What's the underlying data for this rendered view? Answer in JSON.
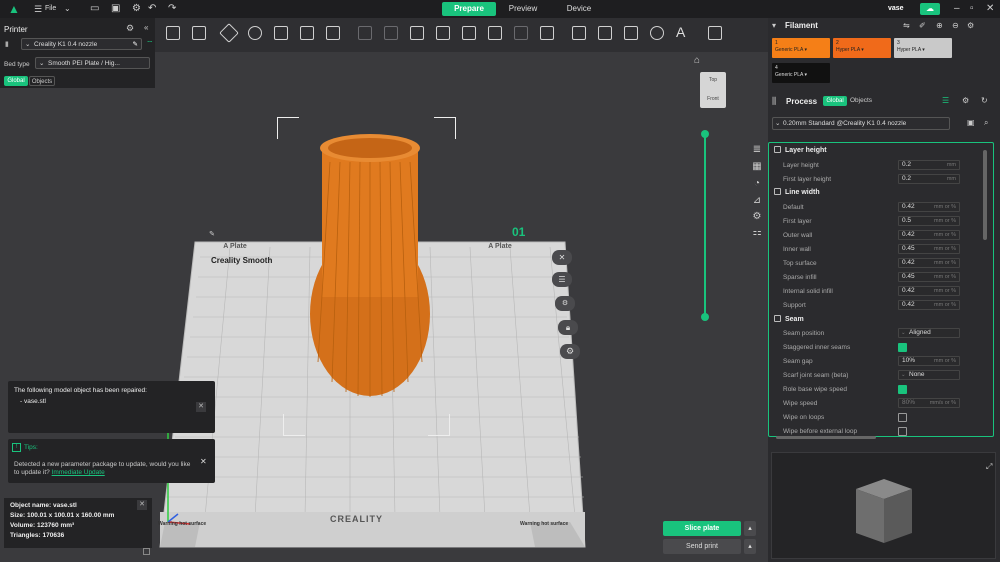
{
  "topbar": {
    "file_label": "File",
    "tabs": [
      "Prepare",
      "Preview",
      "Device"
    ],
    "user": "vase"
  },
  "printer": {
    "title": "Printer",
    "printer_name": "Creality K1 0.4 nozzle",
    "bed_label": "Bed type",
    "bed_value": "Smooth PEI Plate / Hig...",
    "tab_global": "Global",
    "tab_objects": "Objects"
  },
  "plate": {
    "label_left": "A Plate",
    "label_right": "A Plate",
    "name": "Creality Smooth",
    "number": "01",
    "brand": "CREALITY",
    "warning": "Warning hot surface"
  },
  "view_cube": {
    "top": "Top",
    "front": "Front"
  },
  "notices": {
    "repair_title": "The following model object has been repaired:",
    "repair_item": "- vase.stl",
    "tips_title": "Tips:",
    "tips_text": "Detected a new parameter package to update, would you like to update it?",
    "tips_link": "Immediate Update"
  },
  "object_info": {
    "name": "Object name: vase.stl",
    "size": "Size: 100.01 x 100.01 x 160.00 mm",
    "volume": "Volume: 123760 mm³",
    "triangles": "Triangles: 170636"
  },
  "actions": {
    "slice": "Slice plate",
    "send": "Send print"
  },
  "filament": {
    "title": "Filament",
    "slots": [
      {
        "num": "1",
        "name": "Generic PLA ▾",
        "color": "#f57f17"
      },
      {
        "num": "2",
        "name": "Hyper PLA ▾",
        "color": "#f06a1a"
      },
      {
        "num": "3",
        "name": "Hyper PLA ▾",
        "color": "#c9c9c9"
      },
      {
        "num": "4",
        "name": "Generic PLA ▾",
        "color": "#111111"
      }
    ]
  },
  "process": {
    "title": "Process",
    "tab_global": "Global",
    "tab_objects": "Objects",
    "profile": "0.20mm Standard @Creality K1 0.4 nozzle",
    "sections": {
      "layer_height": "Layer height",
      "line_width": "Line width",
      "seam": "Seam"
    },
    "layer_height": [
      {
        "label": "Layer height",
        "value": "0.2",
        "unit": "mm"
      },
      {
        "label": "First layer height",
        "value": "0.2",
        "unit": "mm"
      }
    ],
    "line_width": [
      {
        "label": "Default",
        "value": "0.42",
        "unit": "mm or %"
      },
      {
        "label": "First layer",
        "value": "0.5",
        "unit": "mm or %"
      },
      {
        "label": "Outer wall",
        "value": "0.42",
        "unit": "mm or %"
      },
      {
        "label": "Inner wall",
        "value": "0.45",
        "unit": "mm or %"
      },
      {
        "label": "Top surface",
        "value": "0.42",
        "unit": "mm or %"
      },
      {
        "label": "Sparse infill",
        "value": "0.45",
        "unit": "mm or %"
      },
      {
        "label": "Internal solid infill",
        "value": "0.42",
        "unit": "mm or %"
      },
      {
        "label": "Support",
        "value": "0.42",
        "unit": "mm or %"
      }
    ],
    "seam": {
      "position_label": "Seam position",
      "position_value": "Aligned",
      "staggered_label": "Staggered inner seams",
      "gap_label": "Seam gap",
      "gap_value": "10%",
      "gap_unit": "mm or %",
      "scarf_label": "Scarf joint seam (beta)",
      "scarf_value": "None",
      "role_label": "Role base wipe speed",
      "wipe_speed_label": "Wipe speed",
      "wipe_speed_value": "80%",
      "wipe_speed_unit": "mm/s or %",
      "wipe_loops_label": "Wipe on loops",
      "wipe_before_label": "Wipe before external loop"
    }
  },
  "colors": {
    "accent": "#19c37d",
    "vase": "#e07a1f",
    "bed": "#d8d8d8"
  }
}
